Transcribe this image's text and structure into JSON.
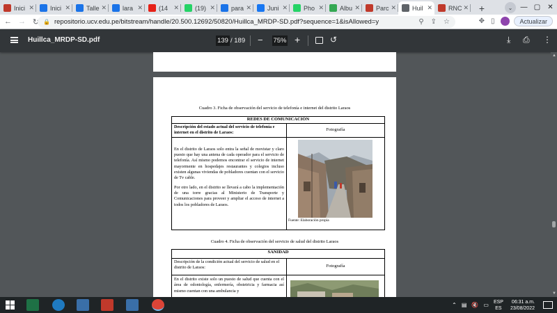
{
  "tabs": [
    {
      "label": "Inici",
      "color": "#c0392b"
    },
    {
      "label": "Inici",
      "color": "#1a73e8"
    },
    {
      "label": "Talle",
      "color": "#1a73e8"
    },
    {
      "label": "lara",
      "color": "#1a73e8"
    },
    {
      "label": "(14",
      "color": "#e62117"
    },
    {
      "label": "(19)",
      "color": "#25d366"
    },
    {
      "label": "para",
      "color": "#1a73e8"
    },
    {
      "label": "Juni",
      "color": "#1877f2"
    },
    {
      "label": "Pho",
      "color": "#25d366"
    },
    {
      "label": "Albu",
      "color": "#34a853"
    },
    {
      "label": "Parc",
      "color": "#c0392b"
    },
    {
      "label": "Huil",
      "color": "#5f6368",
      "active": true
    },
    {
      "label": "RNC",
      "color": "#c0392b"
    }
  ],
  "address": {
    "url": "repositorio.ucv.edu.pe/bitstream/handle/20.500.12692/50820/Huillca_MRDP-SD.pdf?sequence=1&isAllowed=y",
    "update_label": "Actualizar"
  },
  "pdf_toolbar": {
    "title": "Huillca_MRDP-SD.pdf",
    "current_page": "139",
    "total_pages": "/ 189",
    "zoom": "75%"
  },
  "document": {
    "cuadro3": {
      "caption": "Cuadro 3. Ficha de observación del servicio de telefonía e internet del distrito Laraos",
      "section": "REDES DE COMUNICACIÓN",
      "desc_header": "Descripción del estado actual del servicio de telefonía e internet en el distrito de Laraos:",
      "photo_header": "Fotografía",
      "paragraph1": "En el distrito de Laraos solo entra la señal de movistar y claro puesto que hay una antena de cada operador para el servicio de telefonía. Así mismo podemos encontrar el servicio de internet mayormente en hospedajes restaurantes y colegios incluso existen algunas viviendas de pobladores cuentan con el servicio de Tv cable.",
      "paragraph2": "Por otro lado, en el distrito se llevará a cabo la implementación de una torre gracias al Ministerio de Transporte y Comunicaciones para proveer y ampliar el acceso de internet a todos los pobladores de Laraos.",
      "source": "Fuente: Elaboración propia"
    },
    "cuadro4": {
      "caption": "Cuadro 4. Ficha de observación del servicio de salud del distrito Laraos",
      "section": "SANIDAD",
      "desc_header": "Descripción de la condición actual del servicio de salud en el distrito de Laraos:",
      "photo_header": "Fotografía",
      "paragraph1": "En el distrito existe solo un puesto de salud que cuenta con el área de odontología, enfermería, obstetricia y farmacia así mismo cuentan con una ambulancia y"
    }
  },
  "taskbar": {
    "lang_top": "ESP",
    "lang_bottom": "ES",
    "time": "06:31 a.m.",
    "date": "23/08/2022"
  }
}
